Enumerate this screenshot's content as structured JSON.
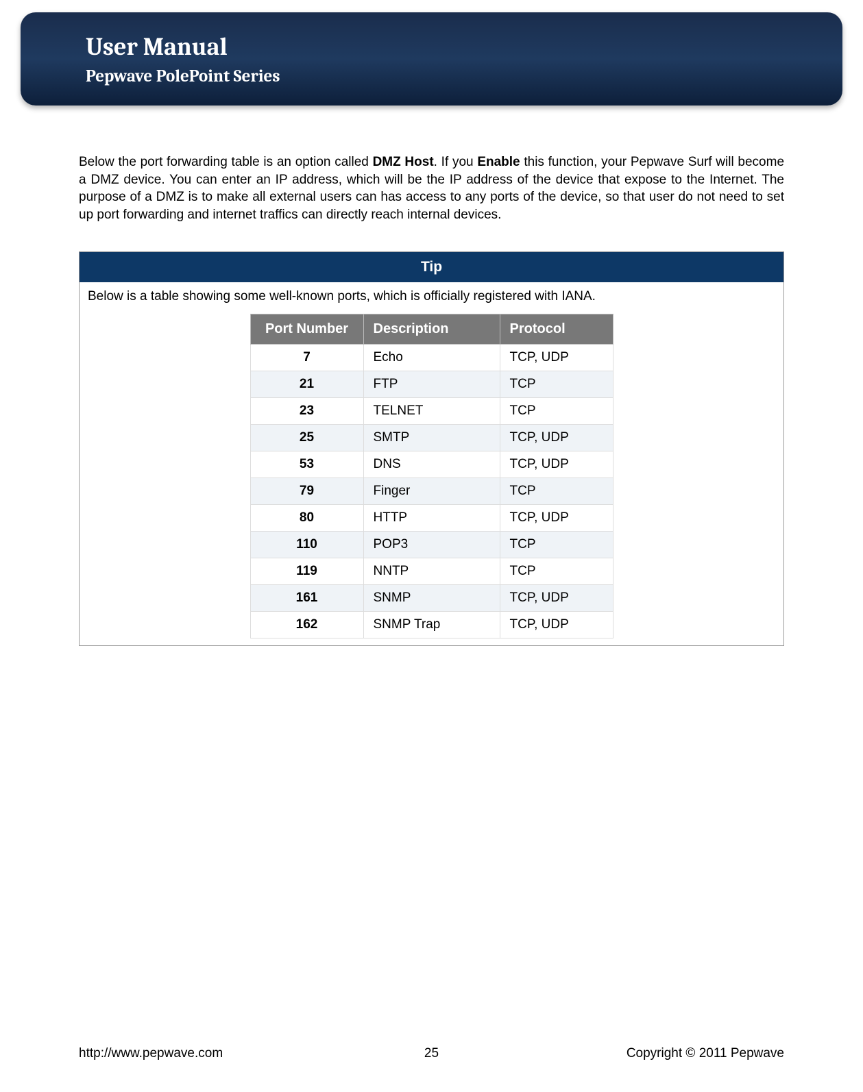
{
  "header": {
    "title": "User Manual",
    "subtitle": "Pepwave PolePoint Series"
  },
  "paragraph": {
    "p1": "Below the port forwarding table is an option called ",
    "bold1": "DMZ Host",
    "p2": ". If you ",
    "bold2": "Enable",
    "p3": " this function, your Pepwave Surf will become a DMZ device. You can enter an IP address, which will be the IP address of the device that expose to the Internet.  The purpose of a DMZ is to make all external users can has access to any ports of the device, so that user do not need to set up port forwarding and internet traffics can directly reach internal devices."
  },
  "tip": {
    "label": "Tip",
    "text": "Below is a table showing some well-known ports, which is officially registered with IANA."
  },
  "table": {
    "headers": [
      "Port Number",
      "Description",
      "Protocol"
    ],
    "rows": [
      {
        "port": "7",
        "desc": "Echo",
        "protocol": "TCP, UDP"
      },
      {
        "port": "21",
        "desc": "FTP",
        "protocol": "TCP"
      },
      {
        "port": "23",
        "desc": "TELNET",
        "protocol": "TCP"
      },
      {
        "port": "25",
        "desc": "SMTP",
        "protocol": "TCP, UDP"
      },
      {
        "port": "53",
        "desc": "DNS",
        "protocol": "TCP, UDP"
      },
      {
        "port": "79",
        "desc": "Finger",
        "protocol": "TCP"
      },
      {
        "port": "80",
        "desc": "HTTP",
        "protocol": "TCP, UDP"
      },
      {
        "port": "110",
        "desc": "POP3",
        "protocol": "TCP"
      },
      {
        "port": "119",
        "desc": "NNTP",
        "protocol": "TCP"
      },
      {
        "port": "161",
        "desc": "SNMP",
        "protocol": "TCP, UDP"
      },
      {
        "port": "162",
        "desc": "SNMP Trap",
        "protocol": "TCP, UDP"
      }
    ]
  },
  "footer": {
    "url": "http://www.pepwave.com",
    "page": "25",
    "copyright": "Copyright © 2011 Pepwave"
  }
}
